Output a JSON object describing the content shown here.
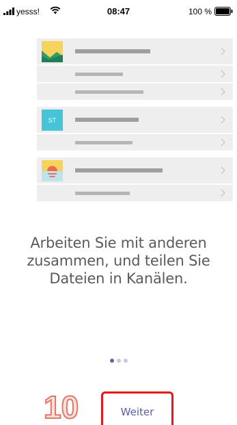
{
  "status_bar": {
    "carrier": "yesss!",
    "time": "08:47",
    "battery": "100 %"
  },
  "illustration": {
    "groups": [
      {
        "icon": "landscape-image-icon",
        "thumb_label": "",
        "rows": 3
      },
      {
        "icon": "team-initials-icon",
        "thumb_label": "ST",
        "rows": 2
      },
      {
        "icon": "sunset-image-icon",
        "thumb_label": "",
        "rows": 2
      }
    ]
  },
  "main": {
    "message": "Arbeiten Sie mit anderen zusammen, und teilen Sie Dateien in Kanälen."
  },
  "pager": {
    "total": 3,
    "active_index": 0
  },
  "footer": {
    "annotation": "10",
    "next_label": "Weiter"
  },
  "colors": {
    "accent": "#6264a7",
    "highlight_box": "#e8161b"
  }
}
